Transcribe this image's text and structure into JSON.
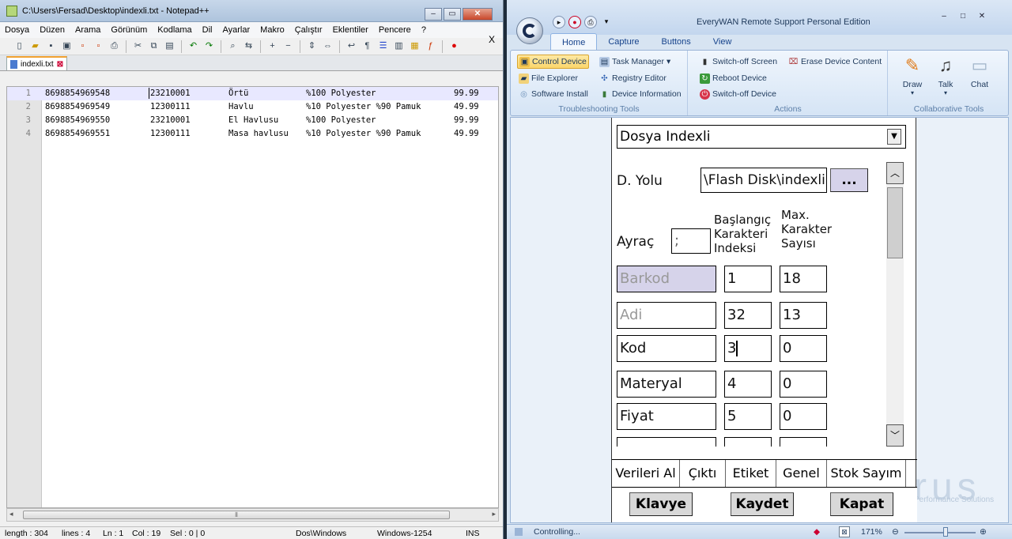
{
  "notepad": {
    "title": "C:\\Users\\Fersad\\Desktop\\indexli.txt - Notepad++",
    "menu": [
      "Dosya",
      "Düzen",
      "Arama",
      "Görünüm",
      "Kodlama",
      "Dil",
      "Ayarlar",
      "Makro",
      "Çalıştır",
      "Eklentiler",
      "Pencere",
      "?"
    ],
    "menu_close": "X",
    "tab_name": "indexli.txt",
    "lines": [
      {
        "num": "1",
        "barcode": "8698854969548",
        "code": "23210001",
        "name": "Örtü",
        "material": "%100 Polyester",
        "price": "99.99"
      },
      {
        "num": "2",
        "barcode": "8698854969549",
        "code": "12300111",
        "name": "Havlu",
        "material": "%10 Polyester %90 Pamuk",
        "price": "49.99"
      },
      {
        "num": "3",
        "barcode": "8698854969550",
        "code": "23210001",
        "name": "El Havlusu",
        "material": "%100 Polyester",
        "price": "99.99"
      },
      {
        "num": "4",
        "barcode": "8698854969551",
        "code": "12300111",
        "name": "Masa havlusu",
        "material": "%10 Polyester %90 Pamuk",
        "price": "49.99"
      }
    ],
    "status": {
      "length": "length : 304",
      "lines": "lines : 4",
      "ln": "Ln : 1",
      "col": "Col : 19",
      "sel": "Sel : 0 | 0",
      "eol": "Dos\\Windows",
      "encoding": "Windows-1254",
      "mode": "INS"
    }
  },
  "everywan": {
    "title": "EveryWAN Remote Support Personal Edition",
    "tabs": [
      "Home",
      "Capture",
      "Buttons",
      "View"
    ],
    "active_tab": "Home",
    "groups": {
      "troubleshooting": {
        "label": "Troubleshooting Tools",
        "items": [
          "Control Device",
          "Task Manager",
          "File Explorer",
          "Registry Editor",
          "Software Install",
          "Device Information"
        ]
      },
      "actions": {
        "label": "Actions",
        "items": [
          "Switch-off Screen",
          "Erase Device Content",
          "Reboot Device",
          "Switch-off Device"
        ]
      },
      "collaborative": {
        "label": "Collaborative Tools",
        "items": [
          "Draw",
          "Talk",
          "Chat"
        ]
      }
    },
    "watermark": "rus",
    "watermark_sub": "Performance Solutions",
    "status_text": "Controlling...",
    "zoom": "171%"
  },
  "device": {
    "dropdown_value": "Dosya Indexli",
    "path_label": "D. Yolu",
    "path_value": "\\Flash Disk\\indexli",
    "browse_label": "...",
    "separator_label": "Ayraç",
    "separator_value": ";",
    "col_start_header": "Başlangıç\nKarakteri\nIndeksi",
    "col_max_header": "Max.\nKarakter\nSayısı",
    "rows": [
      {
        "name": "Barkod",
        "start": "1",
        "max": "18"
      },
      {
        "name": "Adi",
        "start": "32",
        "max": "13"
      },
      {
        "name": "Kod",
        "start": "3",
        "max": "0"
      },
      {
        "name": "Materyal",
        "start": "4",
        "max": "0"
      },
      {
        "name": "Fiyat",
        "start": "5",
        "max": "0"
      }
    ],
    "tabs": [
      "Verileri Al",
      "Çıktı",
      "Etiket",
      "Genel",
      "Stok Sayım"
    ],
    "buttons": {
      "keyboard": "Klavye",
      "save": "Kaydet",
      "close": "Kapat"
    }
  }
}
